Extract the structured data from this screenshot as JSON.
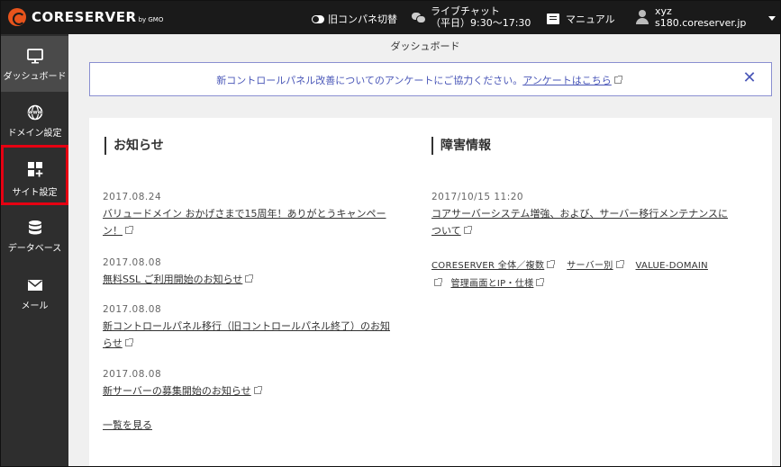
{
  "header": {
    "logo_text": "CORESERVER",
    "logo_sub": "by GMO",
    "legacy_toggle": "旧コンパネ切替",
    "chat_title": "ライブチャット",
    "chat_hours": "（平日）9:30〜17:30",
    "manual": "マニュアル",
    "user_name": "xyz",
    "user_server": "s180.coreserver.jp"
  },
  "sidebar": {
    "items": [
      {
        "label": "ダッシュボード",
        "icon": "monitor-icon"
      },
      {
        "label": "ドメイン設定",
        "icon": "www-globe-icon"
      },
      {
        "label": "サイト設定",
        "icon": "grid-plus-icon"
      },
      {
        "label": "データベース",
        "icon": "database-icon"
      },
      {
        "label": "メール",
        "icon": "mail-icon"
      }
    ],
    "collapse_glyph": "≡"
  },
  "main": {
    "page_title": "ダッシュボード",
    "notice": {
      "text": "新コントロールパネル改善についてのアンケートにご協力ください。",
      "link": "アンケートはこちら",
      "close": "✕"
    },
    "news": {
      "heading": "お知らせ",
      "items": [
        {
          "date": "2017.08.24",
          "title_line1": "バリュードメイン おかげさまで15周年！ありがとうキャンペー",
          "title_line2": "ン！"
        },
        {
          "date": "2017.08.08",
          "title_line1": "無料SSL ご利用開始のお知らせ",
          "title_line2": ""
        },
        {
          "date": "2017.08.08",
          "title_line1": "新コントロールパネル移行（旧コントロールパネル終了）のお知",
          "title_line2": "らせ"
        },
        {
          "date": "2017.08.08",
          "title_line1": "新サーバーの募集開始のお知らせ",
          "title_line2": ""
        }
      ],
      "more": "一覧を見る"
    },
    "failures": {
      "heading": "障害情報",
      "item": {
        "date": "2017/10/15 11:20",
        "title_line1": "コアサーバーシステム増強、および、サーバー移行メンテナンスに",
        "title_line2": "ついて"
      },
      "links": [
        "CORESERVER 全体／複数",
        "サーバー別",
        "VALUE-DOMAIN",
        "管理画面とIP・仕様"
      ]
    }
  }
}
